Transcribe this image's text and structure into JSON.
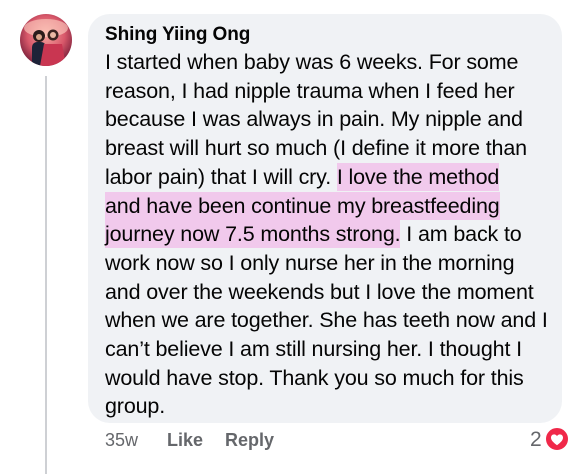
{
  "comment": {
    "author": "Shing Yiing Ong",
    "text_before": "I started when baby was 6 weeks. For some reason, I had nipple trauma when I feed her because I was always in pain. My nipple and breast will hurt so much (I define it more than labor pain) that I will cry. ",
    "text_highlight_1": "I love the method",
    "text_highlight_2": "and have been continue my breastfeeding",
    "text_highlight_3": "journey now 7.5 months strong.",
    "text_after": " I am back to work now so I only nurse her in the morning and over the weekends but I love the moment when we are together. She has teeth now and I can’t believe I am still nursing her. I thought I would have stop. Thank you so much for this group.",
    "highlight_color": "#f1c9ec",
    "bubble_color": "#f0f2f5"
  },
  "actions": {
    "time": "35w",
    "like": "Like",
    "reply": "Reply"
  },
  "reactions": {
    "count": "2",
    "icon": "heart-icon",
    "color": "#f02849"
  },
  "avatar": {
    "icon": "avatar"
  }
}
